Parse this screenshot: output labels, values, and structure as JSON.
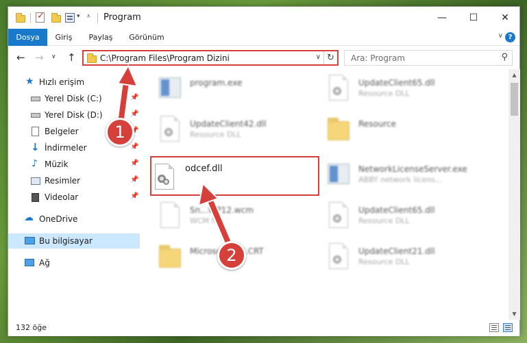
{
  "window": {
    "title": "Program"
  },
  "ribbon": {
    "tabs": [
      "Dosya",
      "Giriş",
      "Paylaş",
      "Görünüm"
    ]
  },
  "address": {
    "path": "C:\\Program Files\\Program Dizini",
    "search_placeholder": "Ara: Program"
  },
  "sidebar": {
    "quick_access": "Hızlı erişim",
    "items": [
      {
        "label": "Yerel Disk (C:)",
        "icon": "drive-icon",
        "pinned": true
      },
      {
        "label": "Yerel Disk (D:)",
        "icon": "drive-icon",
        "pinned": true
      },
      {
        "label": "Belgeler",
        "icon": "documents-icon",
        "pinned": true
      },
      {
        "label": "İndirmeler",
        "icon": "download-icon",
        "pinned": true
      },
      {
        "label": "Müzik",
        "icon": "music-icon",
        "pinned": true
      },
      {
        "label": "Resimler",
        "icon": "pictures-icon",
        "pinned": true
      },
      {
        "label": "Videolar",
        "icon": "video-icon",
        "pinned": true
      }
    ],
    "onedrive": "OneDrive",
    "this_pc": "Bu bilgisayar",
    "network": "Ağ"
  },
  "files": [
    {
      "name": "program.exe",
      "type": "",
      "icon": "exe-icon"
    },
    {
      "name": "UpdateClient65.dll",
      "type": "Resource DLL",
      "icon": "dll-icon"
    },
    {
      "name": "UpdateClient42.dll",
      "type": "Resource DLL",
      "icon": "dll-icon"
    },
    {
      "name": "Resource",
      "type": "",
      "icon": "folder-icon"
    },
    {
      "name": "odcef.dll",
      "type": "",
      "icon": "dll-icon"
    },
    {
      "name": "NetworkLicenseServer.exe",
      "type": "ABBY network licens...",
      "icon": "exe-icon"
    },
    {
      "name": "Sn...WP12.wcm",
      "type": "WCM file",
      "icon": "file-icon"
    },
    {
      "name": "UpdateClient65.dll",
      "type": "Resource DLL",
      "icon": "dll-icon"
    },
    {
      "name": "Microso...C90.CRT",
      "type": "",
      "icon": "folder-icon"
    },
    {
      "name": "UpdateClient21.dll",
      "type": "Resource DLL",
      "icon": "dll-icon"
    }
  ],
  "status": {
    "item_count": "132 öğe"
  },
  "annotations": {
    "step1": "1",
    "step2": "2"
  },
  "colors": {
    "accent": "#1979ca",
    "highlight": "#d6403a",
    "selected": "#cce8ff"
  }
}
